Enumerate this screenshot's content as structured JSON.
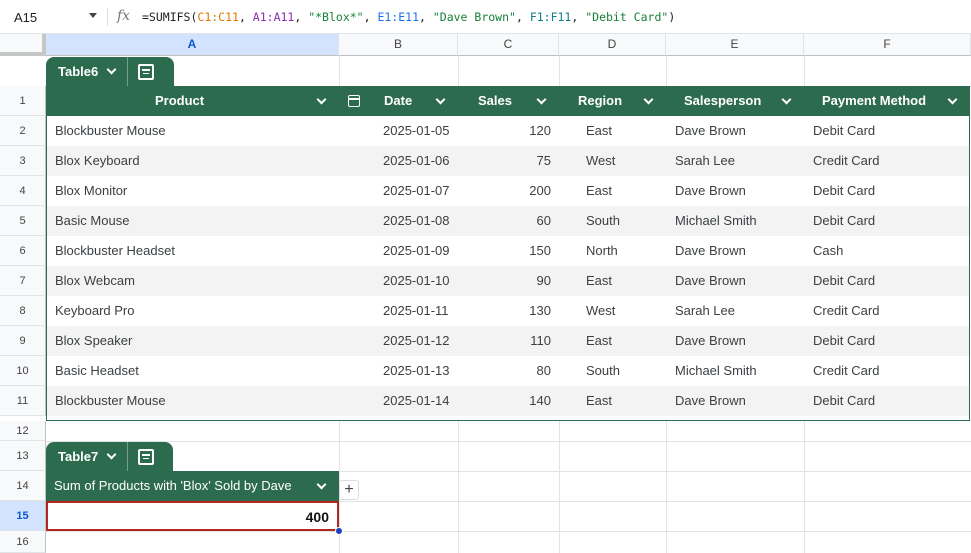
{
  "formula_bar": {
    "name_box": "A15",
    "fx": "fx",
    "formula_parts": [
      {
        "t": "=SUMIFS(",
        "c": ""
      },
      {
        "t": "C1:C11",
        "c": "r-orange"
      },
      {
        "t": ", ",
        "c": ""
      },
      {
        "t": "A1:A11",
        "c": "r-purple"
      },
      {
        "t": ", ",
        "c": ""
      },
      {
        "t": "\"*Blox*\"",
        "c": "r-str"
      },
      {
        "t": ", ",
        "c": ""
      },
      {
        "t": "E1:E11",
        "c": "r-blue"
      },
      {
        "t": ", ",
        "c": ""
      },
      {
        "t": "\"Dave Brown\"",
        "c": "r-str"
      },
      {
        "t": ", ",
        "c": ""
      },
      {
        "t": "F1:F11",
        "c": "r-teal"
      },
      {
        "t": ", ",
        "c": ""
      },
      {
        "t": "\"Debit Card\"",
        "c": "r-str"
      },
      {
        "t": ")",
        "c": ""
      }
    ]
  },
  "columns": [
    "A",
    "B",
    "C",
    "D",
    "E",
    "F"
  ],
  "rows": [
    "1",
    "2",
    "3",
    "4",
    "5",
    "6",
    "7",
    "8",
    "9",
    "10",
    "11",
    "12",
    "13",
    "14",
    "15",
    "16"
  ],
  "table6": {
    "name": "Table6",
    "headers": [
      "Product",
      "Date",
      "Sales",
      "Region",
      "Salesperson",
      "Payment Method"
    ],
    "data": [
      [
        "Blockbuster Mouse",
        "2025-01-05",
        "120",
        "East",
        "Dave Brown",
        "Debit Card"
      ],
      [
        "Blox Keyboard",
        "2025-01-06",
        "75",
        "West",
        "Sarah Lee",
        "Credit Card"
      ],
      [
        "Blox Monitor",
        "2025-01-07",
        "200",
        "East",
        "Dave Brown",
        "Debit Card"
      ],
      [
        "Basic Mouse",
        "2025-01-08",
        "60",
        "South",
        "Michael Smith",
        "Debit Card"
      ],
      [
        "Blockbuster Headset",
        "2025-01-09",
        "150",
        "North",
        "Dave Brown",
        "Cash"
      ],
      [
        "Blox Webcam",
        "2025-01-10",
        "90",
        "East",
        "Dave Brown",
        "Debit Card"
      ],
      [
        "Keyboard Pro",
        "2025-01-11",
        "130",
        "West",
        "Sarah Lee",
        "Credit Card"
      ],
      [
        "Blox Speaker",
        "2025-01-12",
        "110",
        "East",
        "Dave Brown",
        "Debit Card"
      ],
      [
        "Basic Headset",
        "2025-01-13",
        "80",
        "South",
        "Michael Smith",
        "Credit Card"
      ],
      [
        "Blockbuster Mouse",
        "2025-01-14",
        "140",
        "East",
        "Dave Brown",
        "Debit Card"
      ]
    ]
  },
  "table7": {
    "name": "Table7",
    "header": "Sum of Products with 'Blox'  Sold by Dave",
    "value": "400"
  },
  "add_column": "+",
  "colors": {
    "table_header": "#2d6b4f",
    "selection_border": "#b3261e",
    "header_selected": "#d3e3fd"
  }
}
